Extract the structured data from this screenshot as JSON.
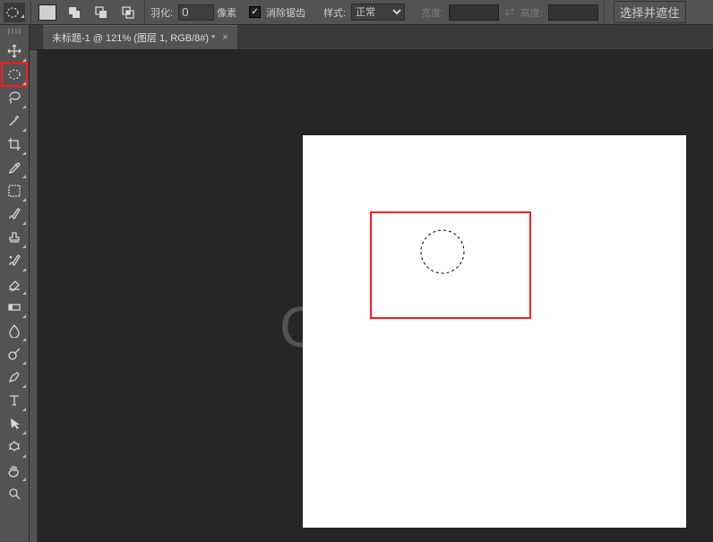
{
  "options_bar": {
    "feather_label": "羽化:",
    "feather_value": "0",
    "feather_unit": "像素",
    "antialias_checked": true,
    "antialias_label": "消除锯齿",
    "style_label": "样式:",
    "style_value": "正常",
    "width_label": "宽度:",
    "width_value": "",
    "height_label": "高度:",
    "height_value": "",
    "select_and_mask": "选择并遮住"
  },
  "tab": {
    "title": "未标题-1 @ 121% (图层 1, RGB/8#) *"
  },
  "watermark": "G"
}
